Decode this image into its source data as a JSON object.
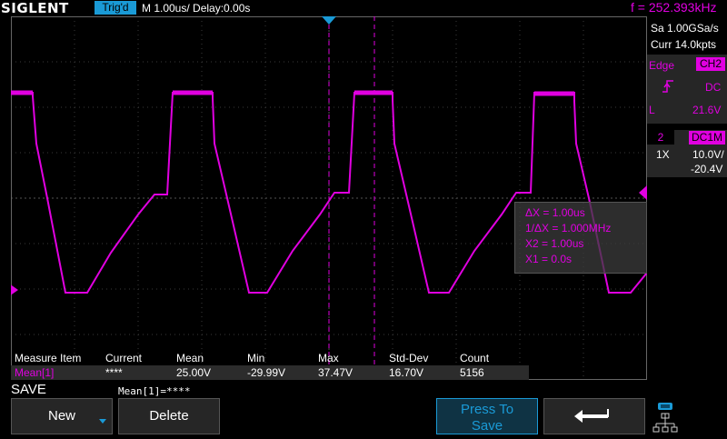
{
  "header": {
    "logo": "SIGLENT",
    "trigger_status": "Trig'd",
    "timebase": "M 1.00us/  Delay:0.00s",
    "frequency": "f = 252.393kHz"
  },
  "acquisition": {
    "sample_rate": "Sa 1.00GSa/s",
    "memory": "Curr 14.0kpts"
  },
  "trigger": {
    "type": "Edge",
    "source": "CH2",
    "coupling": "DC",
    "level_label": "L",
    "level": "21.6V"
  },
  "channel": {
    "number": "2",
    "coupling": "DC1M",
    "probe": "1X",
    "volts_div": "10.0V/",
    "offset": "-20.4V"
  },
  "cursor": {
    "delta_x": "ΔX = 1.00us",
    "inv_delta_x": "1/ΔX = 1.000MHz",
    "x2": "X2 = 1.00us",
    "x1": "X1 = 0.0s"
  },
  "measure": {
    "headers": [
      "Measure Item",
      "Current",
      "Mean",
      "Min",
      "Max",
      "Std-Dev",
      "Count"
    ],
    "row": {
      "name": "Mean[1]",
      "current": "****",
      "mean": "25.00V",
      "min": "-29.99V",
      "max": "37.47V",
      "std_dev": "16.70V",
      "count": "5156"
    }
  },
  "bottom": {
    "menu_title": "SAVE",
    "stat_line": "Mean[1]=****",
    "new_label": "New",
    "delete_label": "Delete",
    "press_label_1": "Press To",
    "press_label_2": "Save"
  },
  "colors": {
    "trace": "#e000e0",
    "accent": "#1a9ad6",
    "grid": "#3a3a3a"
  },
  "icons": [
    "trigger-rising-edge-icon",
    "return-arrow-icon",
    "network-icon",
    "dropdown-arrow-icon"
  ]
}
